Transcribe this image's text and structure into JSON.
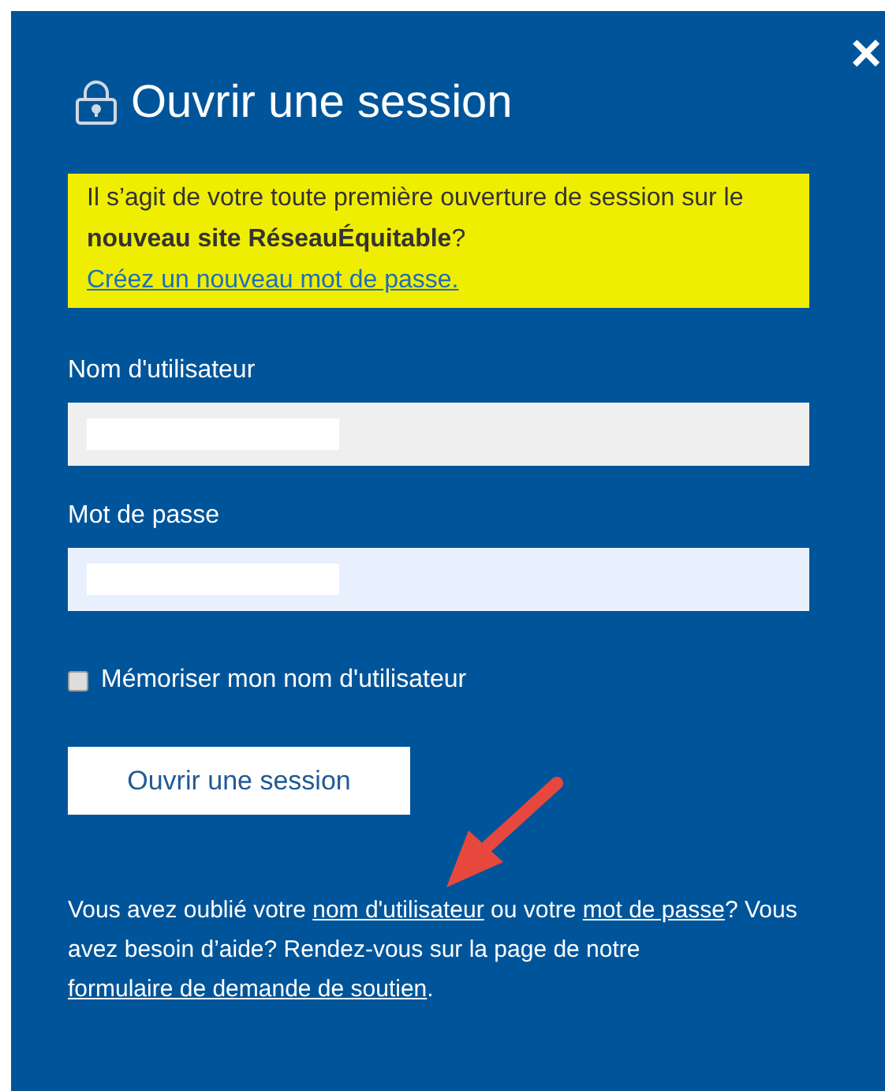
{
  "dialog": {
    "close": "×",
    "title": "Ouvrir une session"
  },
  "notice": {
    "text": "Il s’agit de votre toute première ouverture de session sur le **nouveau site RéseauÉquitable**?",
    "link": "Créez un nouveau mot de passe."
  },
  "fields": [
    {
      "label": "Nom d'utilisateur",
      "kind": "text"
    },
    {
      "label": "Mot de passe",
      "kind": "password"
    }
  ],
  "remember": {
    "label": "Mémoriser mon nom d'utilisateur",
    "checked": false
  },
  "submit": "Ouvrir une session",
  "help": [
    {
      "kind": "text",
      "text": "Vous avez oublié votre "
    },
    {
      "kind": "link",
      "text": "nom d'utilisateur"
    },
    {
      "kind": "text",
      "text": " ou votre "
    },
    {
      "kind": "link",
      "text": "mot de passe"
    },
    {
      "kind": "text",
      "text": "? Vous avez besoin d’aide? Rendez-vous sur la page de notre "
    },
    {
      "kind": "link",
      "text": "formulaire de demande de soutien"
    },
    {
      "kind": "text",
      "text": "."
    }
  ]
}
